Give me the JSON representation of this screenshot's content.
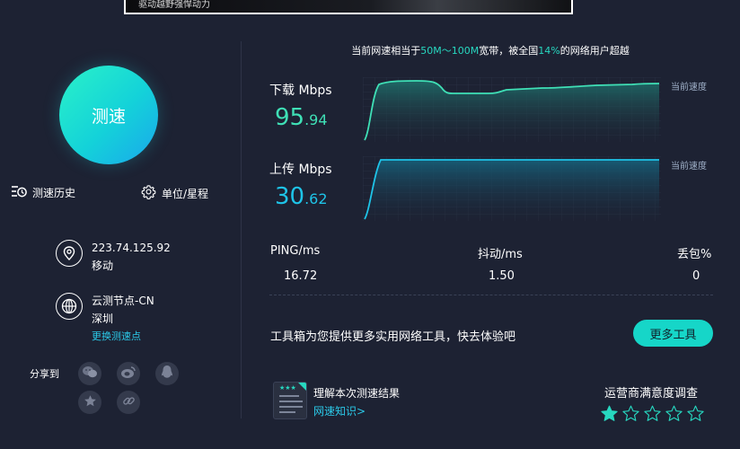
{
  "banner": {
    "text": "驱动越野强悍动力"
  },
  "left": {
    "speed_button": "测速",
    "history": "测速历史",
    "unit": "单位/星程",
    "ip": "223.74.125.92",
    "isp": "移动",
    "node": "云测节点-CN",
    "node_city": "深圳",
    "change_node": "更换测速点",
    "share_label": "分享到"
  },
  "summary": {
    "prefix": "当前网速相当于",
    "range": "50M～100M",
    "middle": "宽带，被全国",
    "percent": "14%",
    "suffix": "的网络用户超越"
  },
  "download": {
    "label": "下载 Mbps",
    "int": "95",
    "dec": ".94",
    "current_label": "当前速度",
    "color": "#3fe0b6"
  },
  "upload": {
    "label": "上传 Mbps",
    "int": "30",
    "dec": ".62",
    "current_label": "当前速度",
    "color": "#1ec4e8"
  },
  "stats": {
    "ping_label": "PING/ms",
    "ping": "16.72",
    "jitter_label": "抖动/ms",
    "jitter": "1.50",
    "loss_label": "丢包%",
    "loss": "0"
  },
  "toolbox": {
    "text": "工具箱为您提供更多实用网络工具，快去体验吧",
    "button": "更多工具"
  },
  "knowledge": {
    "title": "理解本次测速结果",
    "link": "网速知识>"
  },
  "survey": {
    "title": "运营商满意度调查",
    "rating": 1,
    "max": 5
  },
  "colors": {
    "background": "#1d2233",
    "accent": "#16d6c8",
    "link": "#2bc9e8"
  }
}
